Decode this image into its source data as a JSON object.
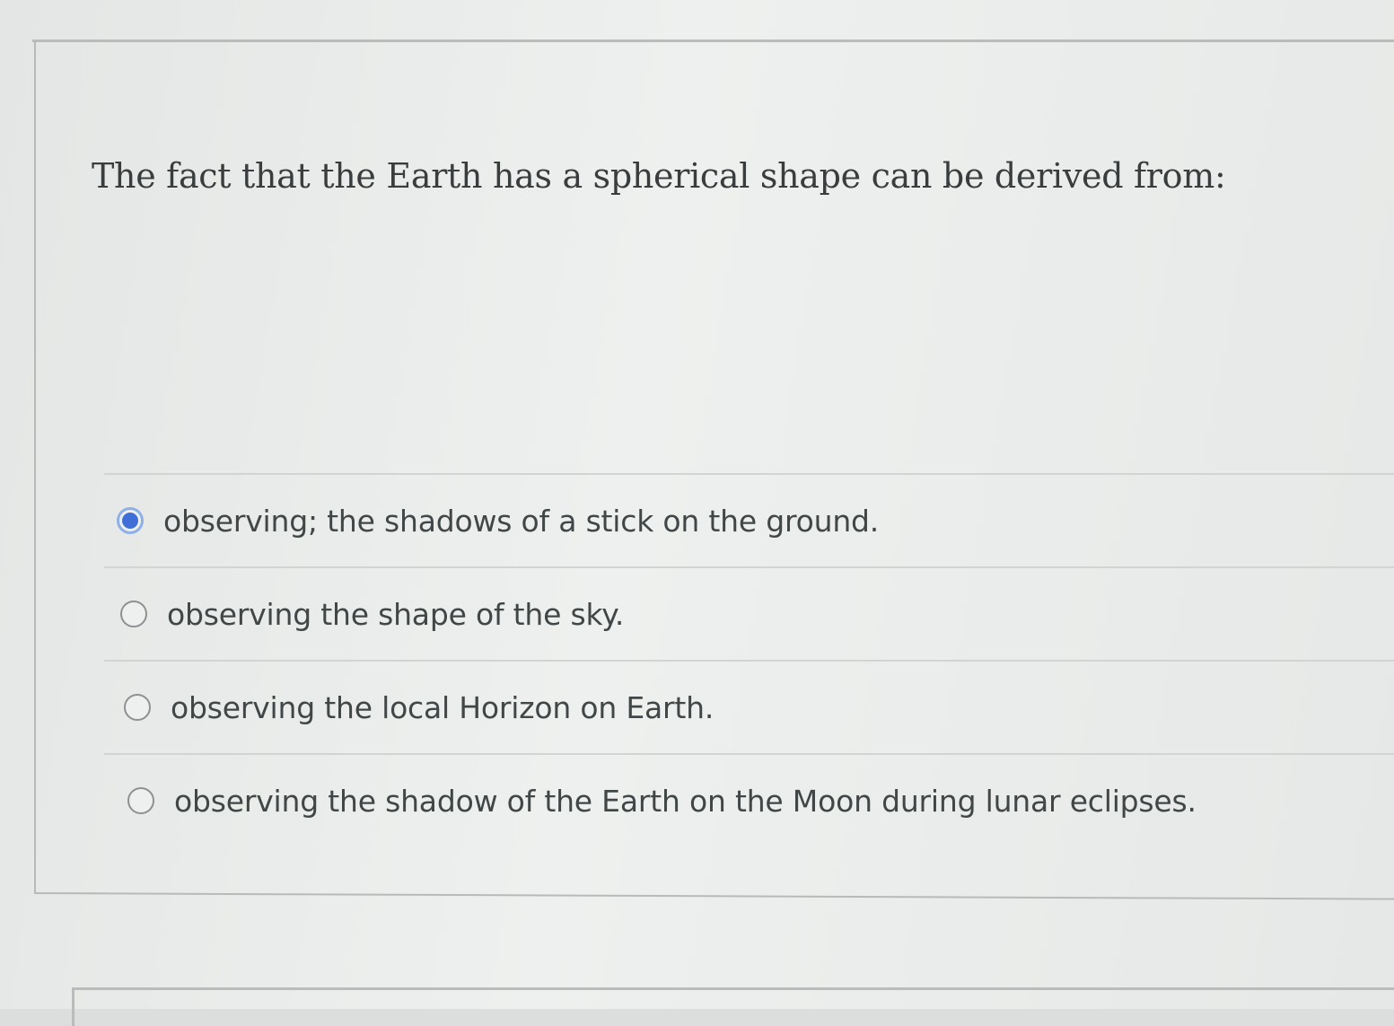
{
  "question": {
    "text": "The fact that the Earth has a spherical shape can be derived from:"
  },
  "options": [
    {
      "label": "observing; the shadows of a stick on the ground.",
      "selected": true
    },
    {
      "label": "observing the shape of the sky.",
      "selected": false
    },
    {
      "label": "observing the local Horizon on Earth.",
      "selected": false
    },
    {
      "label": "observing the shadow of the Earth on the Moon during lunar eclipses.",
      "selected": false
    }
  ],
  "colors": {
    "radio_selected": "#3f6fd6",
    "text": "#414647",
    "background": "#e8eaea"
  }
}
